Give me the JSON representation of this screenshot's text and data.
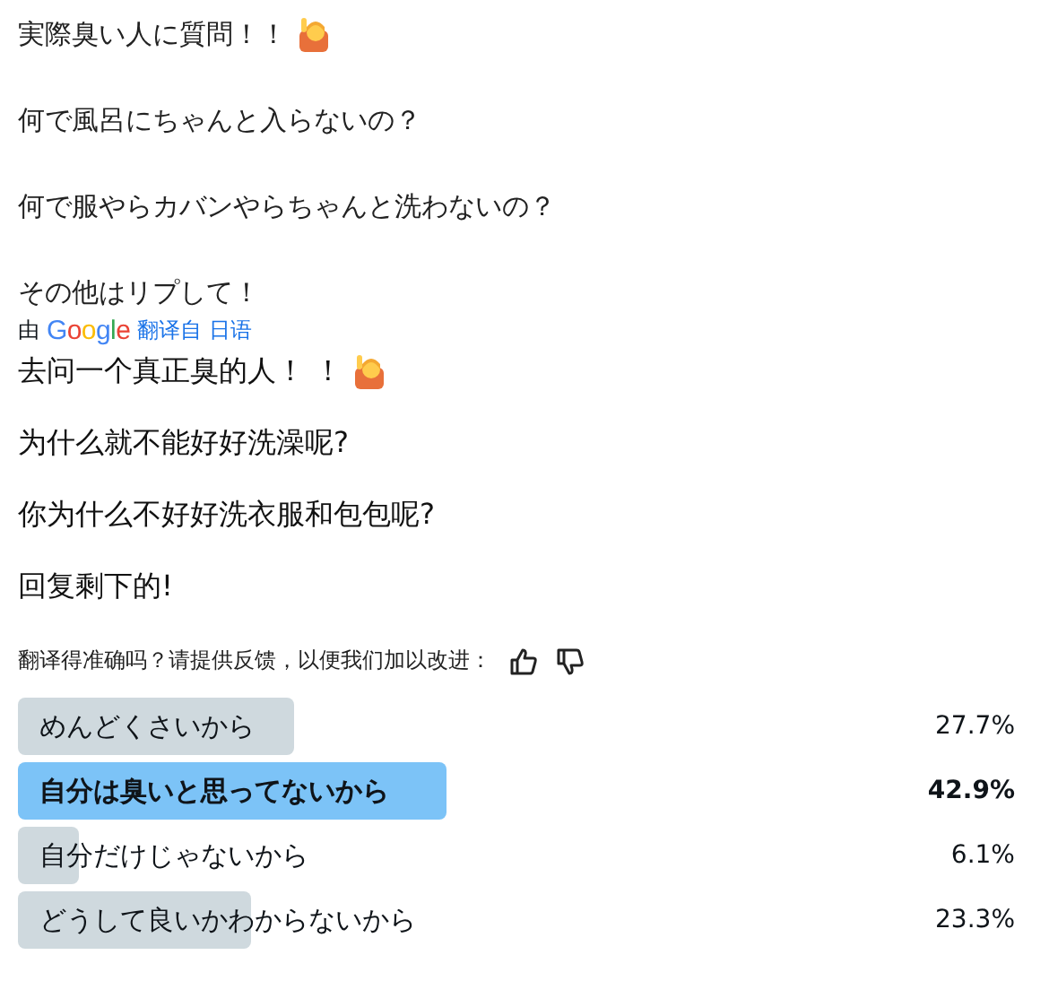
{
  "original": {
    "paragraphs": [
      {
        "text": "実際臭い人に質問！！",
        "kind": "with_emoji"
      },
      {
        "text": "何で風呂にちゃんと入らないの？",
        "kind": "text"
      },
      {
        "text": "何で服やらカバンやらちゃんと洗わないの？",
        "kind": "text"
      },
      {
        "text": "その他はリプして！",
        "kind": "text"
      }
    ]
  },
  "translation_credit": {
    "prefix": "由",
    "brand": "Google",
    "link": "翻译自 日语"
  },
  "translated": {
    "paragraphs": [
      {
        "text": "去问一个真正臭的人！ ！",
        "kind": "with_emoji"
      },
      {
        "text": "为什么就不能好好洗澡呢?",
        "kind": "text"
      },
      {
        "text": "你为什么不好好洗衣服和包包呢?",
        "kind": "text"
      },
      {
        "text": "回复剩下的!",
        "kind": "text"
      }
    ]
  },
  "feedback": {
    "prompt": "翻译得准确吗？请提供反馈，以便我们加以改进："
  },
  "poll": {
    "options": [
      {
        "label": "めんどくさいから",
        "percent": "27.7%",
        "selected": false
      },
      {
        "label": "自分は臭いと思ってないから",
        "percent": "42.9%",
        "selected": true
      },
      {
        "label": "自分だけじゃないから",
        "percent": "6.1%",
        "selected": false
      },
      {
        "label": "どうして良いかわからないから",
        "percent": "23.3%",
        "selected": false
      }
    ]
  }
}
